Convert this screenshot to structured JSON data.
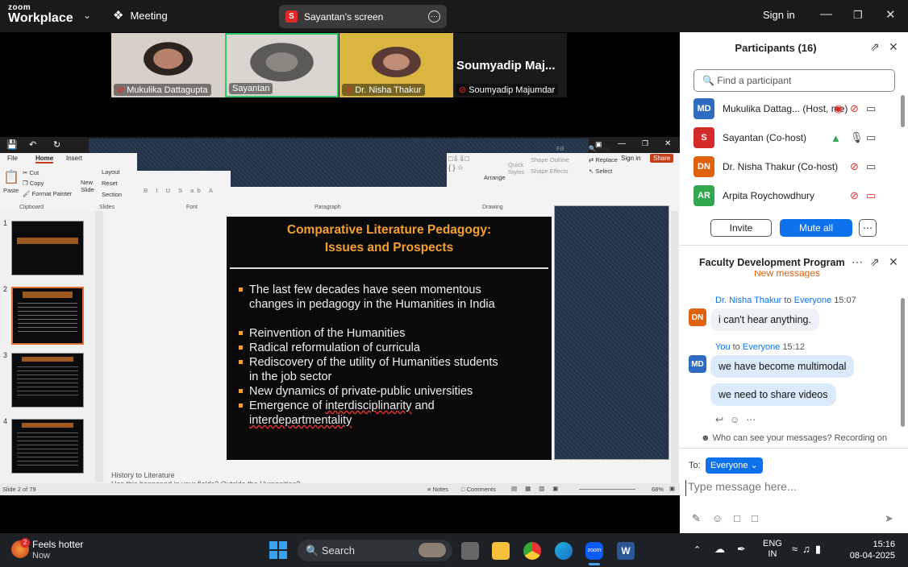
{
  "zoom": {
    "brand_top": "zoom",
    "brand_bottom": "Workplace",
    "meeting_label": "Meeting",
    "share_badge": "S",
    "share_title": "Sayantan's screen",
    "sign_in": "Sign in"
  },
  "videos": [
    {
      "name": "Mukulika Dattagupta"
    },
    {
      "name": "Sayantan"
    },
    {
      "name": "Dr. Nisha Thakur"
    },
    {
      "name": "Soumyadip Majumdar",
      "big_label": "Soumyadip  Maj..."
    }
  ],
  "ppt": {
    "tabs": [
      "File",
      "Home",
      "Insert"
    ],
    "clipboard": {
      "paste": "Paste",
      "cut": "Cut",
      "copy": "Copy",
      "format_painter": "Format Painter",
      "group": "Clipboard"
    },
    "slides_group": {
      "new_slide": "New Slide",
      "layout": "Layout",
      "reset": "Reset",
      "section": "Section",
      "group": "Slides"
    },
    "font_group": "Font",
    "paragraph_group": "Paragraph",
    "drawing_group": "Drawing",
    "drawing": {
      "arrange": "Arrange",
      "quick_styles": "Quick Styles",
      "shape_outline": "Shape Outline",
      "shape_effects": "Shape Effects",
      "fill": "Fill"
    },
    "editing": {
      "find": "Find",
      "replace": "Replace",
      "select": "Select"
    },
    "sign_in": "Sign in",
    "share": "Share",
    "thumb_numbers": [
      "1",
      "2",
      "3",
      "4"
    ],
    "slide": {
      "title_line1": "Comparative Literature Pedagogy:",
      "title_line2": "Issues and Prospects",
      "b1a": "The last few decades have seen momentous",
      "b1b": "changes in pedagogy in the Humanities in India",
      "b2": "Reinvention of the Humanities",
      "b3": "Radical reformulation of curricula",
      "b4a": "Rediscovery of the utility of Humanities students",
      "b4b": "in the job sector",
      "b5": "New dynamics of private-public universities",
      "b6a": "Emergence of ",
      "b6b": "interdisciplinarity",
      "b6c": " and",
      "b7": "interdepartmentality"
    },
    "notes_line1": "History to Literature",
    "notes_line2": "Has this happened in your fields? Outside the Humanities?",
    "status_slide": "Slide 2 of 79",
    "status_notes": "Notes",
    "status_comments": "Comments",
    "zoom_level": "68%"
  },
  "participants": {
    "title": "Participants (16)",
    "search_placeholder": "Find a participant",
    "list": [
      {
        "initials": "MD",
        "name": "Mukulika Dattag... (Host, me)",
        "color": "#2d6cc0"
      },
      {
        "initials": "S",
        "name": "Sayantan (Co-host)",
        "color": "#d42a2a"
      },
      {
        "initials": "DN",
        "name": "Dr. Nisha Thakur (Co-host)",
        "color": "#e0620e"
      },
      {
        "initials": "AR",
        "name": "Arpita Roychowdhury",
        "color": "#2fa84f"
      }
    ],
    "invite": "Invite",
    "mute_all": "Mute all"
  },
  "chat": {
    "title": "Faculty Development Program",
    "new_messages": "New messages",
    "m1_sender": "Dr. Nisha Thakur",
    "to_word": "to",
    "m1_to": "Everyone",
    "m1_time": "15:07",
    "m1_text": "i can't hear anything.",
    "m2_sender": "You",
    "m2_to": "Everyone",
    "m2_time": "15:12",
    "m2_text1": "we have become multimodal",
    "m2_text2": "we need to share videos",
    "visibility": "Who can see your messages? Recording on",
    "to_label": "To:",
    "to_value": "Everyone",
    "placeholder": "Type message here..."
  },
  "taskbar": {
    "weather_badge": "2",
    "weather_title": "Feels hotter",
    "weather_sub": "Now",
    "search": "Search",
    "lang1": "ENG",
    "lang2": "IN",
    "time": "15:16",
    "date": "08-04-2025"
  }
}
